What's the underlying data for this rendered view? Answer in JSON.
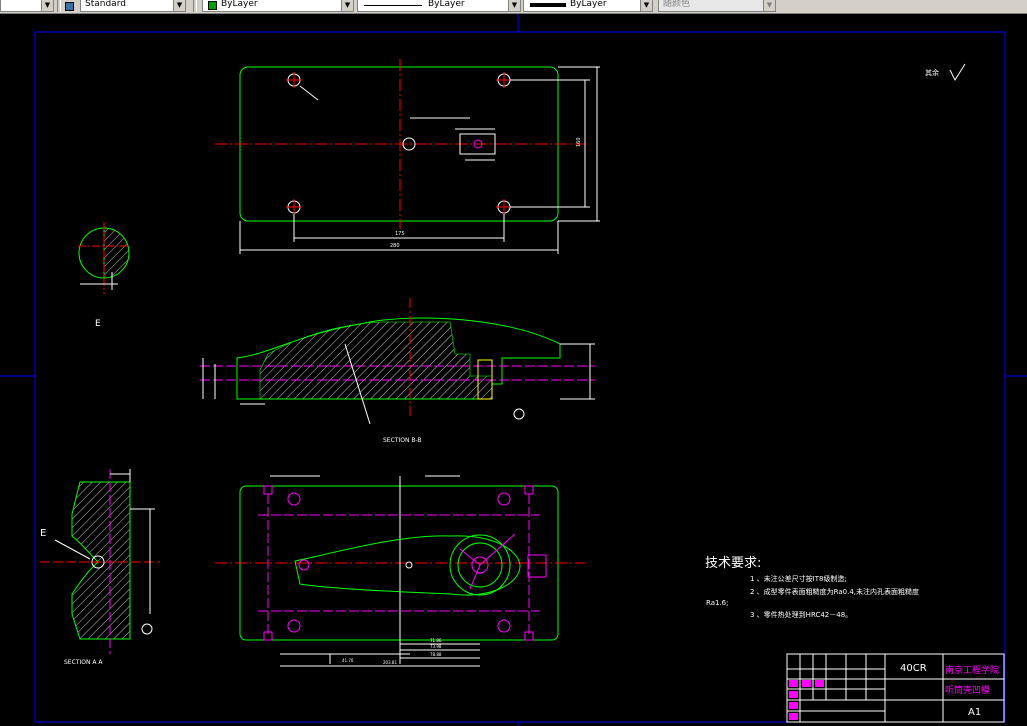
{
  "toolbar": {
    "text_style": "Standard",
    "layer": "ByLayer",
    "linetype": "ByLayer",
    "lineweight": "ByLayer",
    "plot_style": "随颜色"
  },
  "drawing": {
    "section_bb": "SECTION B-B",
    "section_aa": "SECTION A A",
    "detail_e": "E",
    "label_e": "E",
    "roughness_other": "其余",
    "tech": {
      "heading": "技术要求:",
      "items": [
        "1 、未注公差尺寸按IT8级制造;",
        "2 、成型零件表面粗糙度为Ra0.4,未注内孔表面粗糙度",
        "3 、零件热处理到HRC42－48。"
      ],
      "ra": "Ra1.6;"
    },
    "title_block": {
      "material": "40CR",
      "school": "南京工程学院",
      "part": "听筒壳凹模",
      "size": "A1"
    },
    "dims": {
      "d_175": "175",
      "d_280": "280",
      "d_160": "160",
      "d_71": "71.86",
      "d_73": "73.98",
      "d_78": "78.88",
      "d_203": "203.81",
      "d_41": "41.70"
    }
  },
  "colors": {
    "outline": "#00ff00",
    "centerline": "#ff0000",
    "dimension": "#ffffff",
    "hatch": "#ffffff",
    "magenta": "#ff00ff",
    "yellow": "#ffff00",
    "border": "#0000ff",
    "text": "#ffffff"
  }
}
